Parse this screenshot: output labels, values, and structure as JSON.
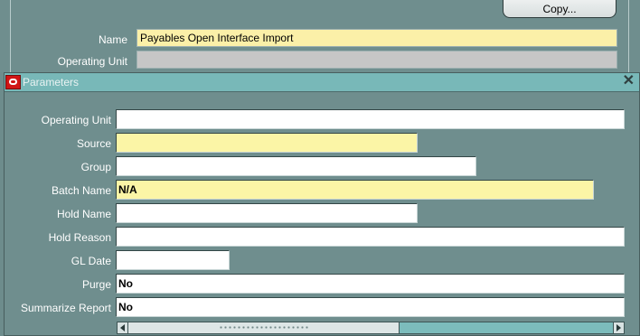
{
  "background_form": {
    "copy_button": "Copy...",
    "name_label": "Name",
    "name_value": "Payables Open Interface Import",
    "operating_unit_label": "Operating Unit",
    "operating_unit_value": ""
  },
  "dialog": {
    "title": "Parameters",
    "close_icon": "close-icon",
    "app_icon": "oracle-icon",
    "fields": [
      {
        "label": "Operating Unit",
        "value": "",
        "required": false
      },
      {
        "label": "Source",
        "value": "",
        "required": true
      },
      {
        "label": "Group",
        "value": "",
        "required": false
      },
      {
        "label": "Batch Name",
        "value": "N/A",
        "required": true
      },
      {
        "label": "Hold Name",
        "value": "",
        "required": false
      },
      {
        "label": "Hold Reason",
        "value": "",
        "required": false
      },
      {
        "label": "GL Date",
        "value": "",
        "required": false
      },
      {
        "label": "Purge",
        "value": "No",
        "required": false
      },
      {
        "label": "Summarize Report",
        "value": "No",
        "required": false
      }
    ]
  },
  "colors": {
    "required_field": "#fbf5a6",
    "titlebar": "#78b8b8",
    "background": "#6d8c8c"
  }
}
